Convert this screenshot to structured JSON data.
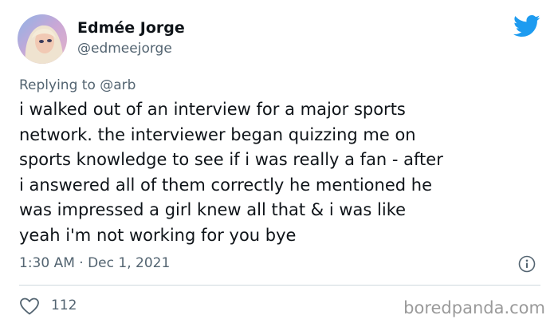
{
  "author": {
    "display_name": "Edmée Jorge",
    "handle": "@edmeejorge",
    "avatar_icon": "profile-photo"
  },
  "platform_icon": "twitter-bird-icon",
  "reply": {
    "prefix": "Replying to",
    "mention": "@arb"
  },
  "tweet": {
    "lines": [
      "i walked out of an interview for a major sports",
      "network. the interviewer began quizzing me on",
      "sports knowledge to see if i was really a fan - after",
      "i answered all of them correctly he mentioned he",
      "was impressed a girl knew all that & i was like",
      "yeah i'm not working for you bye"
    ],
    "timestamp": "1:30 AM · Dec 1, 2021"
  },
  "engagement": {
    "likes": "112"
  },
  "watermark": "boredpanda.com",
  "colors": {
    "twitter_blue": "#1d9bf0",
    "text": "#0f1419",
    "muted": "#536471"
  }
}
